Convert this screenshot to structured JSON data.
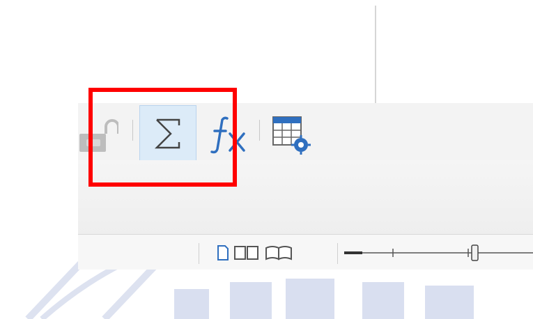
{
  "toolbar": {
    "lock_icon": "unlock-icon",
    "sum_icon": "sigma-icon",
    "function_icon": "fx-icon",
    "table_icon": "table-properties-icon",
    "accent_color": "#2f6fbf"
  },
  "status_bar": {
    "view_icons": [
      "single-page-view-icon",
      "multi-page-view-icon",
      "book-view-icon"
    ],
    "zoom_slider": "zoom-slider"
  },
  "highlight_color": "#ff0000"
}
